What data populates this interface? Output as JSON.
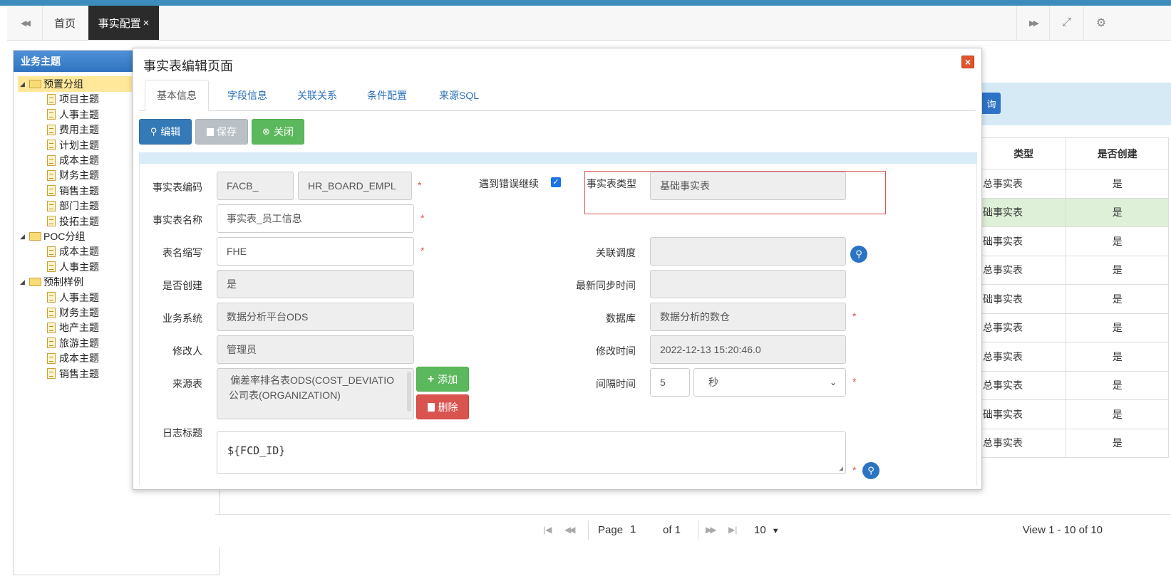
{
  "topnav": {
    "home_tab": "首页",
    "active_tab": "事实配置",
    "close_icon": "×",
    "back_icon": "◀◀",
    "forward_icon": "▶▶",
    "fullscreen_icon": "⤢",
    "settings_icon": "⚙"
  },
  "sidebar": {
    "title": "业务主题",
    "groups": [
      {
        "label": "预置分组",
        "items": [
          "项目主题",
          "人事主题",
          "费用主题",
          "计划主题",
          "成本主题",
          "财务主题",
          "销售主题",
          "部门主题",
          "投拓主题"
        ]
      },
      {
        "label": "POC分组",
        "items": [
          "成本主题",
          "人事主题"
        ]
      },
      {
        "label": "预制样例",
        "items": [
          "人事主题",
          "财务主题",
          "地产主题",
          "旅游主题",
          "成本主题",
          "销售主题"
        ]
      }
    ]
  },
  "background": {
    "query_btn": "询",
    "col_type": "类型",
    "col_created": "是否创建",
    "rows": [
      {
        "type": "总事实表",
        "created": "是"
      },
      {
        "type": "础事实表",
        "created": "是"
      },
      {
        "type": "础事实表",
        "created": "是"
      },
      {
        "type": "总事实表",
        "created": "是"
      },
      {
        "type": "础事实表",
        "created": "是"
      },
      {
        "type": "总事实表",
        "created": "是"
      },
      {
        "type": "总事实表",
        "created": "是"
      },
      {
        "type": "总事实表",
        "created": "是"
      },
      {
        "type": "础事实表",
        "created": "是"
      },
      {
        "type": "总事实表",
        "created": "是"
      }
    ],
    "pager": {
      "page_label": "Page",
      "page_value": "1",
      "of_label": "of 1",
      "page_size": "10",
      "view_text": "View 1 - 10 of 10"
    }
  },
  "modal": {
    "title": "事实表编辑页面",
    "tabs": [
      "基本信息",
      "字段信息",
      "关联关系",
      "条件配置",
      "来源SQL"
    ],
    "buttons": {
      "edit": "编辑",
      "save": "保存",
      "close": "关闭",
      "add": "添加",
      "delete": "删除"
    },
    "fields": {
      "code_label": "事实表编码",
      "code_prefix": "FACB_",
      "code_value": "HR_BOARD_EMPL",
      "continue_on_error_label": "遇到错误继续",
      "continue_on_error_checked": true,
      "type_label": "事实表类型",
      "type_value": "基础事实表",
      "name_label": "事实表名称",
      "name_value": "事实表_员工信息",
      "abbr_label": "表名缩写",
      "abbr_value": "FHE",
      "schedule_label": "关联调度",
      "schedule_value": "",
      "created_label": "是否创建",
      "created_value": "是",
      "sync_time_label": "最新同步时间",
      "sync_time_value": "",
      "system_label": "业务系统",
      "system_value": "数据分析平台ODS",
      "database_label": "数据库",
      "database_value": "数据分析的数仓",
      "modifier_label": "修改人",
      "modifier_value": "管理员",
      "modified_time_label": "修改时间",
      "modified_time_value": "2022-12-13 15:20:46.0",
      "source_label": "来源表",
      "source_lines": [
        "偏差率排名表ODS(COST_DEVIATIO",
        "公司表(ORGANIZATION)"
      ],
      "interval_label": "间隔时间",
      "interval_value": "5",
      "interval_unit": "秒",
      "log_label": "日志标题",
      "log_value": "${FCD_ID}"
    },
    "required_mark": "*"
  }
}
